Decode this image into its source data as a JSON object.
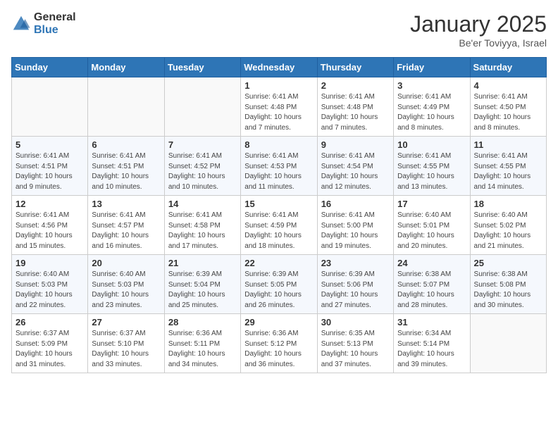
{
  "logo": {
    "general": "General",
    "blue": "Blue"
  },
  "header": {
    "title": "January 2025",
    "subtitle": "Be'er Toviyya, Israel"
  },
  "columns": [
    "Sunday",
    "Monday",
    "Tuesday",
    "Wednesday",
    "Thursday",
    "Friday",
    "Saturday"
  ],
  "weeks": [
    [
      {
        "day": "",
        "info": ""
      },
      {
        "day": "",
        "info": ""
      },
      {
        "day": "",
        "info": ""
      },
      {
        "day": "1",
        "info": "Sunrise: 6:41 AM\nSunset: 4:48 PM\nDaylight: 10 hours and 7 minutes."
      },
      {
        "day": "2",
        "info": "Sunrise: 6:41 AM\nSunset: 4:48 PM\nDaylight: 10 hours and 7 minutes."
      },
      {
        "day": "3",
        "info": "Sunrise: 6:41 AM\nSunset: 4:49 PM\nDaylight: 10 hours and 8 minutes."
      },
      {
        "day": "4",
        "info": "Sunrise: 6:41 AM\nSunset: 4:50 PM\nDaylight: 10 hours and 8 minutes."
      }
    ],
    [
      {
        "day": "5",
        "info": "Sunrise: 6:41 AM\nSunset: 4:51 PM\nDaylight: 10 hours and 9 minutes."
      },
      {
        "day": "6",
        "info": "Sunrise: 6:41 AM\nSunset: 4:51 PM\nDaylight: 10 hours and 10 minutes."
      },
      {
        "day": "7",
        "info": "Sunrise: 6:41 AM\nSunset: 4:52 PM\nDaylight: 10 hours and 10 minutes."
      },
      {
        "day": "8",
        "info": "Sunrise: 6:41 AM\nSunset: 4:53 PM\nDaylight: 10 hours and 11 minutes."
      },
      {
        "day": "9",
        "info": "Sunrise: 6:41 AM\nSunset: 4:54 PM\nDaylight: 10 hours and 12 minutes."
      },
      {
        "day": "10",
        "info": "Sunrise: 6:41 AM\nSunset: 4:55 PM\nDaylight: 10 hours and 13 minutes."
      },
      {
        "day": "11",
        "info": "Sunrise: 6:41 AM\nSunset: 4:55 PM\nDaylight: 10 hours and 14 minutes."
      }
    ],
    [
      {
        "day": "12",
        "info": "Sunrise: 6:41 AM\nSunset: 4:56 PM\nDaylight: 10 hours and 15 minutes."
      },
      {
        "day": "13",
        "info": "Sunrise: 6:41 AM\nSunset: 4:57 PM\nDaylight: 10 hours and 16 minutes."
      },
      {
        "day": "14",
        "info": "Sunrise: 6:41 AM\nSunset: 4:58 PM\nDaylight: 10 hours and 17 minutes."
      },
      {
        "day": "15",
        "info": "Sunrise: 6:41 AM\nSunset: 4:59 PM\nDaylight: 10 hours and 18 minutes."
      },
      {
        "day": "16",
        "info": "Sunrise: 6:41 AM\nSunset: 5:00 PM\nDaylight: 10 hours and 19 minutes."
      },
      {
        "day": "17",
        "info": "Sunrise: 6:40 AM\nSunset: 5:01 PM\nDaylight: 10 hours and 20 minutes."
      },
      {
        "day": "18",
        "info": "Sunrise: 6:40 AM\nSunset: 5:02 PM\nDaylight: 10 hours and 21 minutes."
      }
    ],
    [
      {
        "day": "19",
        "info": "Sunrise: 6:40 AM\nSunset: 5:03 PM\nDaylight: 10 hours and 22 minutes."
      },
      {
        "day": "20",
        "info": "Sunrise: 6:40 AM\nSunset: 5:03 PM\nDaylight: 10 hours and 23 minutes."
      },
      {
        "day": "21",
        "info": "Sunrise: 6:39 AM\nSunset: 5:04 PM\nDaylight: 10 hours and 25 minutes."
      },
      {
        "day": "22",
        "info": "Sunrise: 6:39 AM\nSunset: 5:05 PM\nDaylight: 10 hours and 26 minutes."
      },
      {
        "day": "23",
        "info": "Sunrise: 6:39 AM\nSunset: 5:06 PM\nDaylight: 10 hours and 27 minutes."
      },
      {
        "day": "24",
        "info": "Sunrise: 6:38 AM\nSunset: 5:07 PM\nDaylight: 10 hours and 28 minutes."
      },
      {
        "day": "25",
        "info": "Sunrise: 6:38 AM\nSunset: 5:08 PM\nDaylight: 10 hours and 30 minutes."
      }
    ],
    [
      {
        "day": "26",
        "info": "Sunrise: 6:37 AM\nSunset: 5:09 PM\nDaylight: 10 hours and 31 minutes."
      },
      {
        "day": "27",
        "info": "Sunrise: 6:37 AM\nSunset: 5:10 PM\nDaylight: 10 hours and 33 minutes."
      },
      {
        "day": "28",
        "info": "Sunrise: 6:36 AM\nSunset: 5:11 PM\nDaylight: 10 hours and 34 minutes."
      },
      {
        "day": "29",
        "info": "Sunrise: 6:36 AM\nSunset: 5:12 PM\nDaylight: 10 hours and 36 minutes."
      },
      {
        "day": "30",
        "info": "Sunrise: 6:35 AM\nSunset: 5:13 PM\nDaylight: 10 hours and 37 minutes."
      },
      {
        "day": "31",
        "info": "Sunrise: 6:34 AM\nSunset: 5:14 PM\nDaylight: 10 hours and 39 minutes."
      },
      {
        "day": "",
        "info": ""
      }
    ]
  ]
}
